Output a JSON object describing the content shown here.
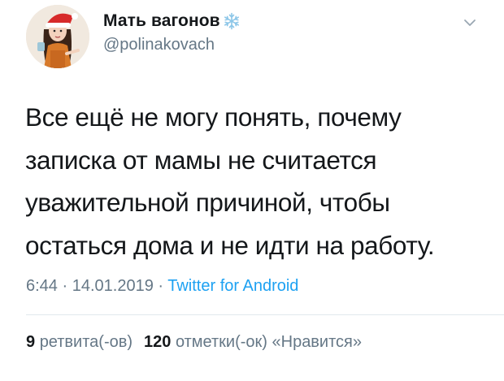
{
  "author": {
    "display_name": "Мать вагонов",
    "handle": "@polinakovach",
    "avatar_icon": "avatar-girl-santa-hat",
    "badge_icon": "snowflake-icon"
  },
  "tweet": {
    "lines": [
      "Все ещё не могу понять, почему",
      "записка от мамы не считается",
      "уважительной причиной, чтобы",
      "остаться дома и не идти на работу."
    ]
  },
  "meta": {
    "time": "6:44",
    "separator1": " · ",
    "date": "14.01.2019",
    "separator2": " · ",
    "source": "Twitter for Android"
  },
  "stats": {
    "retweets_count": "9",
    "retweets_label": "ретвита(-ов)",
    "likes_count": "120",
    "likes_label": "отметки(-ок) «Нравится»"
  },
  "colors": {
    "text": "#14171a",
    "secondary": "#657786",
    "link": "#1da1f2",
    "divider": "#e1e8ed"
  }
}
